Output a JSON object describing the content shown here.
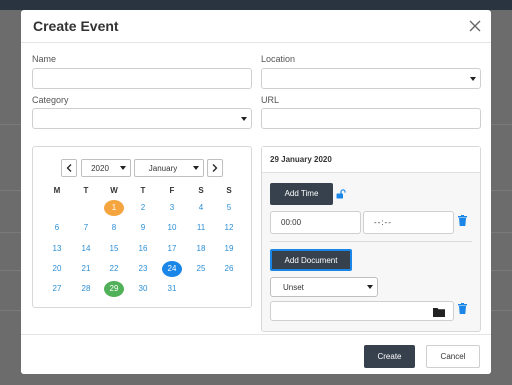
{
  "dialog": {
    "title": "Create Event",
    "close_icon": "close-icon"
  },
  "form": {
    "name_label": "Name",
    "name_value": "",
    "location_label": "Location",
    "location_value": "",
    "category_label": "Category",
    "category_value": "",
    "url_label": "URL",
    "url_value": ""
  },
  "calendar": {
    "year": "2020",
    "month": "January",
    "weekdays": [
      "M",
      "T",
      "W",
      "T",
      "F",
      "S",
      "S"
    ],
    "weeks": [
      [
        "",
        "",
        "1",
        "2",
        "3",
        "4",
        "5"
      ],
      [
        "6",
        "7",
        "8",
        "9",
        "10",
        "11",
        "12"
      ],
      [
        "13",
        "14",
        "15",
        "16",
        "17",
        "18",
        "19"
      ],
      [
        "20",
        "21",
        "22",
        "23",
        "24",
        "25",
        "26"
      ],
      [
        "27",
        "28",
        "29",
        "30",
        "31",
        "",
        ""
      ]
    ],
    "highlight_orange": "1",
    "highlight_blue": "24",
    "highlight_green": "29",
    "colors": {
      "orange": "#f5a540",
      "blue": "#1a86e8",
      "green": "#51b158",
      "day_text": "#2b8fd6"
    }
  },
  "panel": {
    "selected_date": "29 January 2020",
    "add_time_label": "Add Time",
    "unlock_icon": "unlock-icon",
    "time_start": "00:00",
    "time_end": "--:--",
    "add_document_label": "Add Document",
    "document_type": "Unset",
    "document_file": "",
    "folder_icon": "folder-icon",
    "trash_icon": "trash-icon"
  },
  "footer": {
    "create_label": "Create",
    "cancel_label": "Cancel"
  },
  "colors": {
    "primary_dark": "#36414d",
    "accent": "#1a86e8"
  }
}
